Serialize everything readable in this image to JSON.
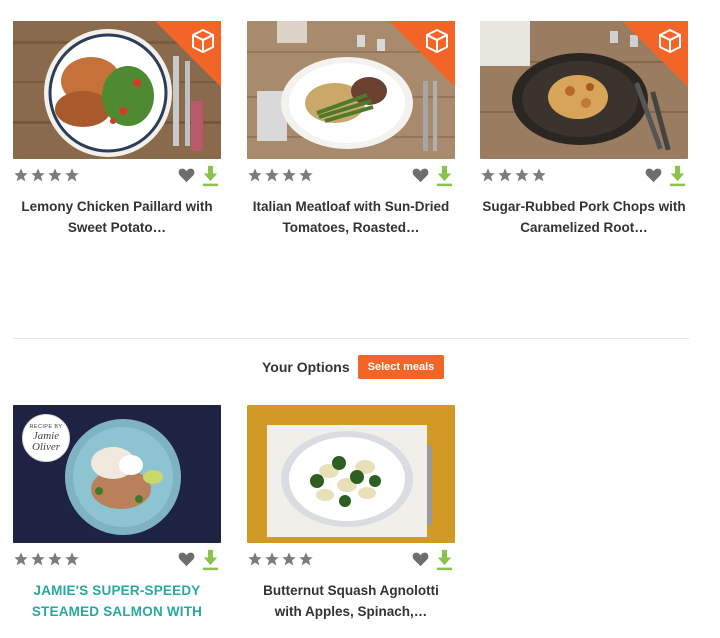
{
  "colors": {
    "accent": "#f26527",
    "download": "#8bc34a",
    "star": "#7d7d7d",
    "teal": "#27a9a2"
  },
  "recipes": [
    {
      "title_line1": "Lemony Chicken Paillard with",
      "title_line2": "Sweet Potato…",
      "rating": 4,
      "badge": "box-icon"
    },
    {
      "title_line1": "Italian Meatloaf with Sun-Dried",
      "title_line2": "Tomatoes, Roasted…",
      "rating": 4,
      "badge": "box-icon"
    },
    {
      "title_line1": "Sugar-Rubbed Pork Chops with",
      "title_line2": "Caramelized Root…",
      "rating": 4,
      "badge": "box-icon"
    }
  ],
  "options": {
    "label": "Your Options",
    "button": "Select meals"
  },
  "option_recipes": [
    {
      "title_line1": "JAMIE'S SUPER-SPEEDY",
      "title_line2": "STEAMED SALMON WITH",
      "rating": 4,
      "badge_small": "RECIPE BY",
      "badge_name1": "Jamie",
      "badge_name2": "Oliver"
    },
    {
      "title_line1": "Butternut Squash Agnolotti",
      "title_line2": "with Apples, Spinach,…",
      "rating": 4
    }
  ]
}
